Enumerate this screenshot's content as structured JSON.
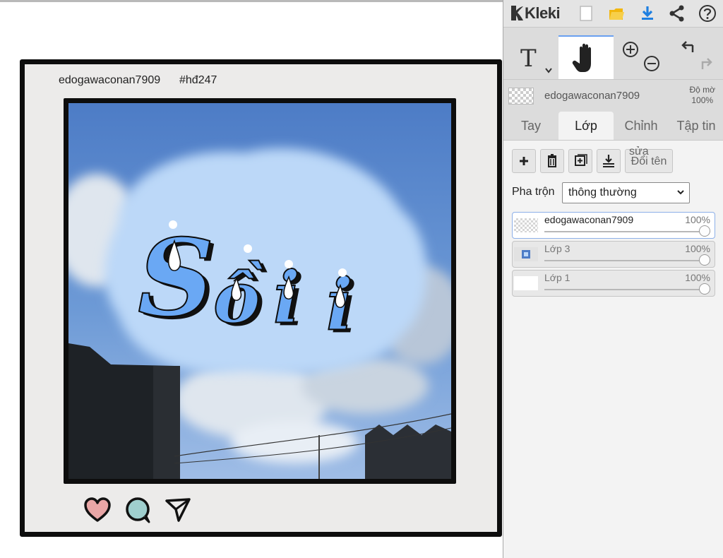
{
  "post": {
    "username": "edogawaconan7909",
    "hashtag": "#hđ247",
    "image_text": "Sồii"
  },
  "app": {
    "name": "Kleki"
  },
  "layer_info": {
    "current_layer": "edogawaconan7909",
    "opacity_label": "Độ mờ",
    "opacity_value": "100%"
  },
  "tabs": [
    {
      "label": "Tay",
      "active": false
    },
    {
      "label": "Lớp",
      "active": true
    },
    {
      "label": "Chỉnh",
      "active": false
    },
    {
      "label": "Tập tin",
      "active": false
    }
  ],
  "layer_panel": {
    "rename_label": "Đổi tên",
    "rename_sub_label": "sửa",
    "blend_label": "Pha trộn",
    "blend_value": "thông thường",
    "layers": [
      {
        "name": "edogawaconan7909",
        "opacity": "100%",
        "selected": true
      },
      {
        "name": "Lớp 3",
        "opacity": "100%",
        "selected": false
      },
      {
        "name": "Lớp 1",
        "opacity": "100%",
        "selected": false
      }
    ]
  },
  "colors": {
    "accent": "#6aa0f0",
    "download": "#1e7fe0",
    "folder": "#f2b60d",
    "heart": "#e9a6a6",
    "bubble": "#9fcfce"
  }
}
